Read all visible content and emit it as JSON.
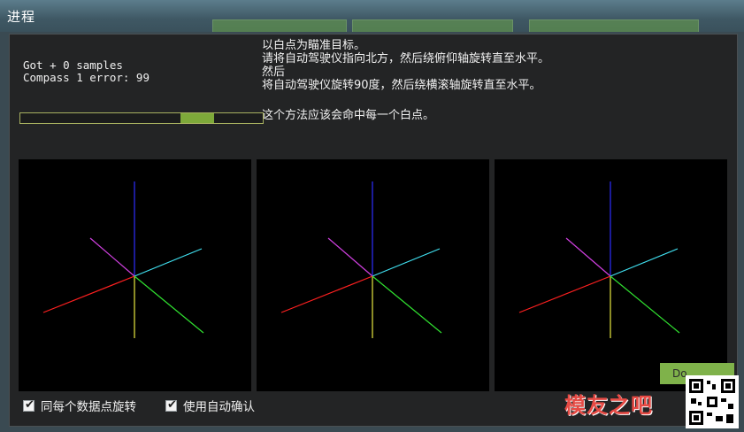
{
  "window": {
    "title": "进程"
  },
  "status": {
    "line1": "Got + 0 samples",
    "line2": "Compass 1 error: 99"
  },
  "progress": {
    "fill_fraction_start": 0.66,
    "fill_fraction_end": 0.8
  },
  "instructions": {
    "line1": "以白点为瞄准目标。",
    "line2": "请将自动驾驶仪指向北方，然后绕俯仰轴旋转直至水平。",
    "line3": "然后",
    "line4": "将自动驾驶仪旋转90度，然后绕横滚轴旋转直至水平。",
    "line5": "这个方法应该会命中每一个白点。"
  },
  "viewports": [
    {
      "name": "compass-view-1"
    },
    {
      "name": "compass-view-2"
    },
    {
      "name": "compass-view-3"
    }
  ],
  "axis_colors": {
    "up": "#2d2dff",
    "down": "#e8e840",
    "magenta": "#d040e0",
    "cyan": "#40e0f0",
    "red": "#ff2020",
    "green": "#30e030"
  },
  "options": {
    "rotate_label": "同每个数据点旋转",
    "rotate_checked": true,
    "autoaccept_label": "使用自动确认",
    "autoaccept_checked": true
  },
  "done_button": {
    "label": "Do"
  },
  "watermark": {
    "text": "模友之吧"
  }
}
